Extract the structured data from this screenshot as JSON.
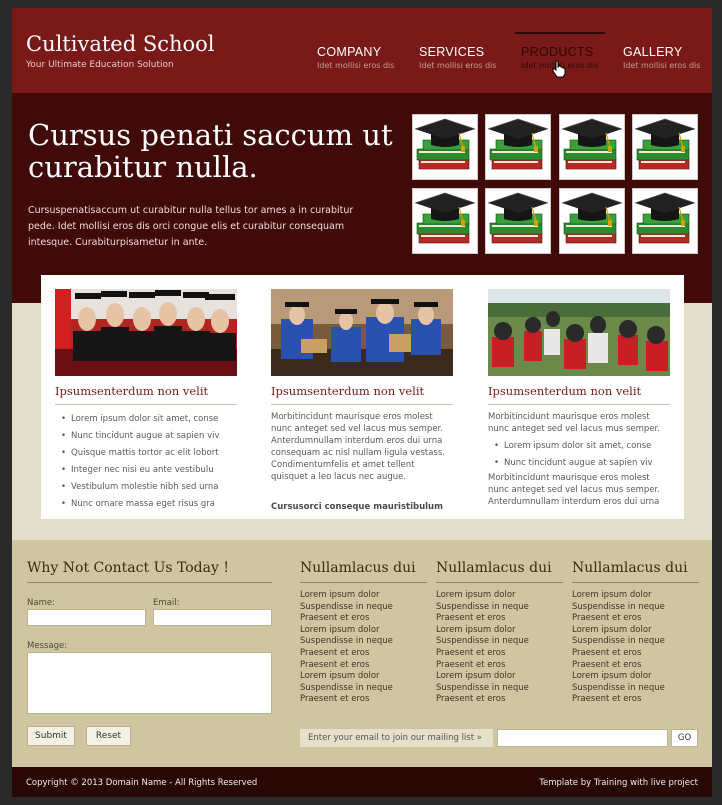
{
  "header": {
    "logo_title": "Cultivated School",
    "logo_tagline": "Your Ultimate Education Solution",
    "nav": [
      {
        "label": "COMPANY",
        "sub": "Idet mollisi eros dis"
      },
      {
        "label": "SERVICES",
        "sub": "Idet mollisi eros dis"
      },
      {
        "label": "PRODUCTS",
        "sub": "Idet mollisi eros dis"
      },
      {
        "label": "GALLERY",
        "sub": "Idet mollisi eros dis"
      }
    ],
    "active_nav": "PRODUCTS"
  },
  "hero": {
    "title": "Cursus penati saccum ut curabitur nulla.",
    "text": "Cursuspenatisaccum ut curabitur nulla tellus tor ames a in curabitur pede. Idet mollisi eros dis orci congue elis et curabitur consequam intesque. Curabiturpisametur in ante.",
    "thumbnails_icon": "graduation-cap-books-icon"
  },
  "cards": [
    {
      "title": "Ipsumsenterdum non velit",
      "list": [
        "Lorem ipsum dolor sit amet, conse",
        "Nunc tincidunt augue at sapien viv",
        "Quisque mattis tortor ac elit lobort",
        "Integer nec nisi eu ante vestibulu",
        "Vestibulum molestie nibh sed urna",
        "Nunc ornare massa eget risus gra"
      ]
    },
    {
      "title": "Ipsumsenterdum non velit",
      "paragraph": "Morbitincidunt maurisque eros molest nunc anteget sed vel lacus mus semper. Anterdumnullam interdum eros dui urna consequam ac nisl nullam ligula vestass. Condimentumfelis et amet tellent quisquet a leo lacus nec augue.",
      "strong": "Cursusorci conseque mauristibulum"
    },
    {
      "title": "Ipsumsenterdum non velit",
      "paragraph": "Morbitincidunt maurisque eros molest nunc anteget sed vel lacus mus semper.",
      "list": [
        "Lorem ipsum dolor sit amet, conse",
        "Nunc tincidunt augue at sapien viv"
      ],
      "paragraph2": "Morbitincidunt maurisque eros molest nunc anteget sed vel lacus mus semper. Anterdumnullam interdum eros dui urna"
    }
  ],
  "contact": {
    "title": "Why Not Contact Us Today !",
    "name_label": "Name:",
    "email_label": "Email:",
    "message_label": "Message:",
    "submit_label": "Submit",
    "reset_label": "Reset"
  },
  "columns": [
    {
      "title": "Nullamlacus dui",
      "items": [
        "Lorem ipsum dolor",
        "Suspendisse in neque",
        "Praesent et eros",
        "Lorem ipsum dolor",
        "Suspendisse in neque",
        "Praesent et eros",
        "Praesent et eros",
        "Lorem ipsum dolor",
        "Suspendisse in neque",
        "Praesent et eros"
      ]
    },
    {
      "title": "Nullamlacus dui",
      "items": [
        "Lorem ipsum dolor",
        "Suspendisse in neque",
        "Praesent et eros",
        "Lorem ipsum dolor",
        "Suspendisse in neque",
        "Praesent et eros",
        "Praesent et eros",
        "Lorem ipsum dolor",
        "Suspendisse in neque",
        "Praesent et eros"
      ]
    },
    {
      "title": "Nullamlacus dui",
      "items": [
        "Lorem ipsum dolor",
        "Suspendisse in neque",
        "Praesent et eros",
        "Lorem ipsum dolor",
        "Suspendisse in neque",
        "Praesent et eros",
        "Praesent et eros",
        "Lorem ipsum dolor",
        "Suspendisse in neque",
        "Praesent et eros"
      ]
    }
  ],
  "mailing": {
    "label": "Enter your email to join our mailing list »",
    "go_label": "GO"
  },
  "footer": {
    "copyright": "Copyright © 2013 Domain Name - All Rights Reserved",
    "credit": "Template by Training with live project"
  },
  "colors": {
    "header_bg": "#7a1a18",
    "hero_bg": "#3f0a08",
    "body_bg": "#e3ddcb",
    "contact_bg": "#cfc5a0",
    "footer_bg": "#290705"
  }
}
